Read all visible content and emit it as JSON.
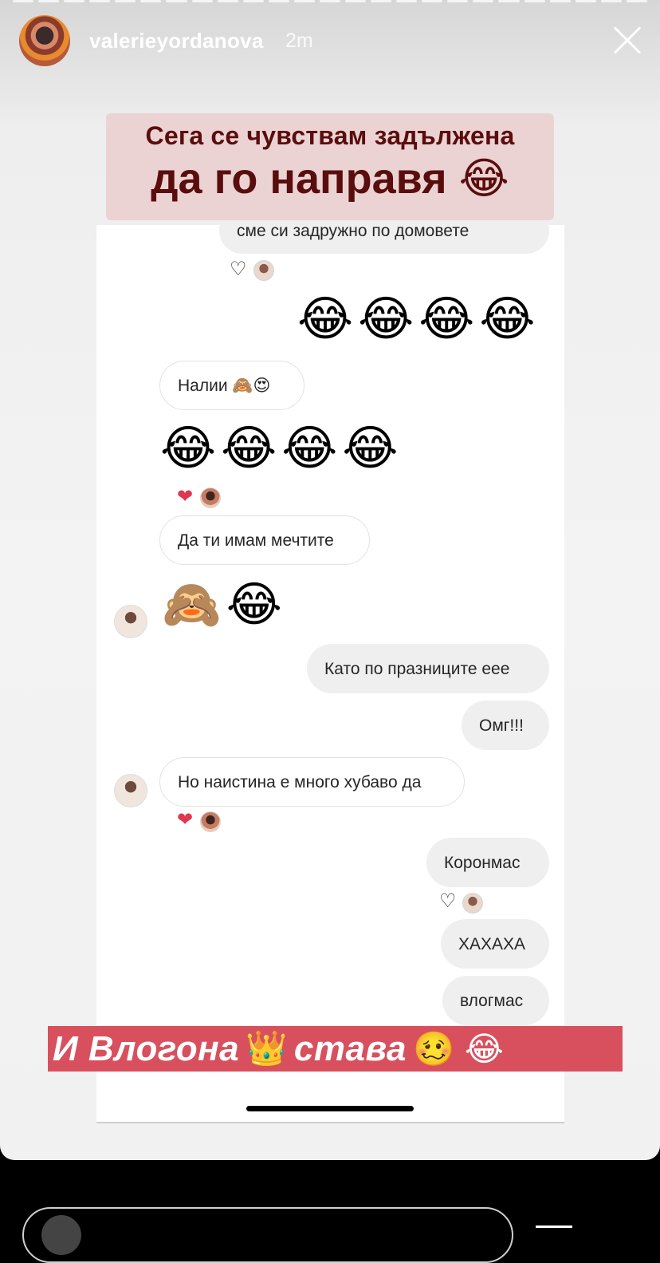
{
  "header": {
    "username": "valerieyordanova",
    "time": "2m",
    "progress_segments": 25
  },
  "stickers": {
    "top_line1": "Сега се чувствам задължена",
    "top_line2": "да го направя 😂",
    "bottom_text": "И Влогона",
    "bottom_crown": "👑",
    "bottom_text2": "става",
    "bottom_emoji": "🥴 😂"
  },
  "chat": {
    "m1": "сме си задружно по домовете",
    "m2_emoji": "😂😂😂😂",
    "m3": "Налии 🙈😍",
    "m4_emoji": "😂😂😂😂",
    "m5": "Да ти имам мечтите",
    "m6_emoji": "🙈😂",
    "m7": "Като по празниците еее",
    "m8": "Омг!!!",
    "m9": "Но наистина е много хубаво да",
    "m10": "Коронмас",
    "m11": "ХАХАХА",
    "m12": "влогмас",
    "reaction_outline": "♡",
    "reaction_red": "❤"
  },
  "colors": {
    "top_sticker_bg": "#ecd3d3",
    "top_sticker_text": "#5a0d0d",
    "bottom_sticker_bg": "#d8505d"
  }
}
